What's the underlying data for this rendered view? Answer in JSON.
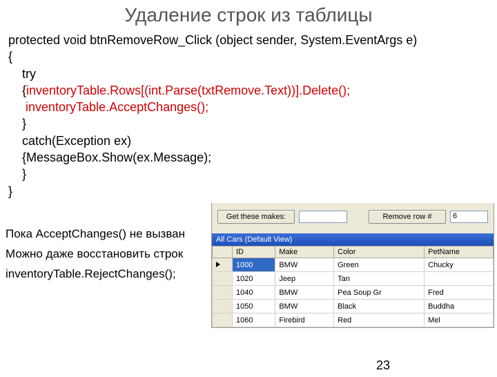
{
  "title": "Удаление строк из таблицы",
  "code": {
    "l1": "protected void btnRemoveRow_Click (object sender, System.EventArgs e)",
    "l2": "{",
    "l3": "    try",
    "l4a": "    {",
    "l4b": "inventoryTable.Rows[(int.Parse(txtRemove.Text))].Delete();",
    "l5": "     inventoryTable.AcceptChanges();",
    "l6": "    }",
    "l7": "    catch(Exception ex)",
    "l8": "    {MessageBox.Show(ex.Message);",
    "l9": "    }",
    "l10": "}"
  },
  "notes": {
    "n1": "Пока AcceptChanges() не вызван",
    "n2": "Можно даже восстановить строк",
    "n3": "inventoryTable.RejectChanges();"
  },
  "pagenum": "23",
  "shot": {
    "get_btn": "Get these makes:",
    "remove_btn": "Remove row #",
    "remove_val": "6",
    "table_title": "All Cars (Default View)",
    "headers": [
      "ID",
      "Make",
      "Color",
      "PetName"
    ],
    "rows": [
      {
        "id": "1000",
        "make": "BMW",
        "color": "Green",
        "pet": "Chucky",
        "selected": true
      },
      {
        "id": "1020",
        "make": "Jeep",
        "color": "Tan",
        "pet": ""
      },
      {
        "id": "1040",
        "make": "BMW",
        "color": "Pea Soup Gr",
        "pet": "Fred"
      },
      {
        "id": "1050",
        "make": "BMW",
        "color": "Black",
        "pet": "Buddha"
      },
      {
        "id": "1060",
        "make": "Firebird",
        "color": "Red",
        "pet": "Mel"
      }
    ]
  }
}
